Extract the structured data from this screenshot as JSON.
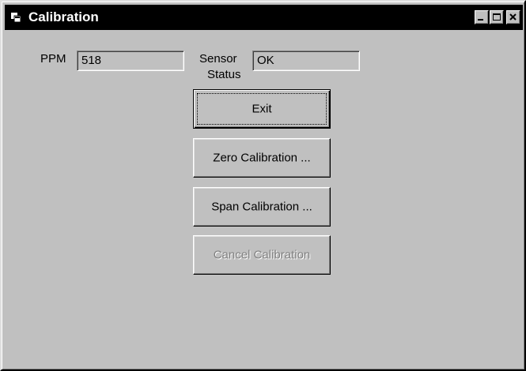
{
  "window": {
    "title": "Calibration"
  },
  "fields": {
    "ppm_label": "PPM",
    "ppm_value": "518",
    "sensor_label_line1": "Sensor",
    "sensor_label_line2": "Status",
    "sensor_value": "OK"
  },
  "buttons": {
    "exit": "Exit",
    "zero_calibration": "Zero Calibration ...",
    "span_calibration": "Span Calibration ...",
    "cancel_calibration": "Cancel Calibration"
  },
  "icons": {
    "window_icon": "app-window-icon",
    "minimize": "minimize-icon",
    "maximize": "maximize-icon",
    "close": "close-icon"
  },
  "colors": {
    "titlebar": "#000000",
    "face": "#c0c0c0",
    "disabled_text": "#808080"
  }
}
